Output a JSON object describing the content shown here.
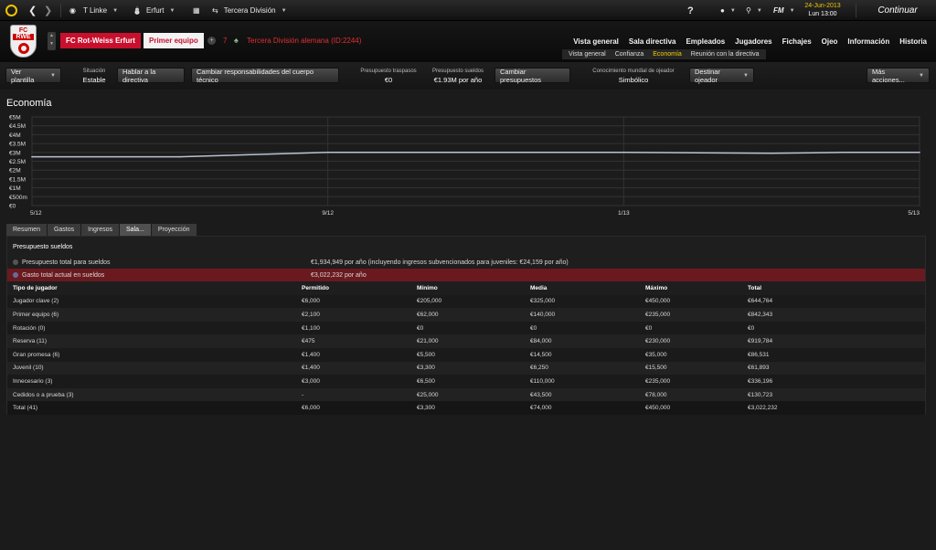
{
  "topbar": {
    "manager": "T Linke",
    "city": "Erfurt",
    "competition": "Tercera División",
    "help": "?",
    "date": "24-Jun-2013",
    "day_time": "Lun 13:00",
    "fm_label": "FM",
    "continue_label": "Continuar"
  },
  "club": {
    "crest_top": "FC",
    "crest_mid": "RWE",
    "name": "FC Rot-Weiss Erfurt",
    "team": "Primer equipo",
    "rank": "7",
    "league": "Tercera División alemana",
    "league_id": "(ID:2244)",
    "accent": "#c8102e"
  },
  "nav": {
    "items": [
      "Vista general",
      "Sala directiva",
      "Empleados",
      "Jugadores",
      "Fichajes",
      "Ojeo",
      "Información",
      "Historia"
    ],
    "subitems": [
      "Vista general",
      "Confianza",
      "Economía",
      "Reunión con la directiva"
    ],
    "active_sub": "Economía"
  },
  "info": {
    "view_squad": "Ver plantilla",
    "situation_label": "Situación",
    "situation_value": "Estable",
    "talk_board": "Hablar a la directiva",
    "change_resp": "Cambiar responsabilidades del cuerpo técnico",
    "transfer_budget_label": "Presupuesto traspasos",
    "transfer_budget_value": "€0",
    "wage_budget_label": "Presupuesto sueldos",
    "wage_budget_value": "€1.93M por año",
    "change_budgets": "Cambiar presupuestos",
    "scout_label": "Conocimiento mundial de ojeador",
    "scout_value": "Simbólico",
    "assign_scout": "Destinar ojeador",
    "more_actions": "Más acciones..."
  },
  "section_title": "Economía",
  "chart_data": {
    "type": "line",
    "title": "",
    "xlabel": "",
    "ylabel": "",
    "y_ticks": [
      "€5M",
      "€4.5M",
      "€4M",
      "€3.5M",
      "€3M",
      "€2.5M",
      "€2M",
      "€1.5M",
      "€1M",
      "€500m",
      "€0"
    ],
    "x_ticks": [
      "5/12",
      "9/12",
      "1/13",
      "5/13"
    ],
    "ylim": [
      0,
      5000000
    ],
    "xlim": [
      0,
      12
    ],
    "grid": true,
    "series": [
      {
        "x": [
          0,
          2,
          4,
          6,
          8,
          10,
          11,
          12
        ],
        "values": [
          2750000,
          2750000,
          3000000,
          3000000,
          3000000,
          2950000,
          3000000,
          3000000
        ]
      }
    ],
    "color": "#b7c3d3"
  },
  "tabs": [
    "Resumen",
    "Gastos",
    "Ingresos",
    "Sala...",
    "Proyección"
  ],
  "active_tab": "Sala...",
  "wages": {
    "title": "Presupuesto sueldos",
    "budget_label": "Presupuesto total para sueldos",
    "budget_value": "€1,934,949 por año (incluyendo ingresos subvencionados para juveniles: €24,159 por año)",
    "current_label": "Gasto total actual en sueldos",
    "current_value": "€3,022,232 por año",
    "warn_color": "#6a1a1f",
    "columns": [
      "Tipo de jugador",
      "Permitido",
      "Mínimo",
      "Media",
      "Máximo",
      "Total"
    ],
    "rows": [
      [
        "Jugador clave (2)",
        "€6,000",
        "€205,000",
        "€325,000",
        "€450,000",
        "€644,764"
      ],
      [
        "Primer equipo (6)",
        "€2,100",
        "€62,000",
        "€140,000",
        "€235,000",
        "€842,343"
      ],
      [
        "Rotación (0)",
        "€1,100",
        "€0",
        "€0",
        "€0",
        "€0"
      ],
      [
        "Reserva (11)",
        "€475",
        "€21,000",
        "€84,000",
        "€230,000",
        "€919,784"
      ],
      [
        "Gran promesa (6)",
        "€1,400",
        "€5,500",
        "€14,500",
        "€35,000",
        "€86,531"
      ],
      [
        "Juvenil (10)",
        "€1,400",
        "€3,300",
        "€6,250",
        "€15,500",
        "€61,893"
      ],
      [
        "Innecesario (3)",
        "€3,000",
        "€6,500",
        "€110,000",
        "€235,000",
        "€336,196"
      ],
      [
        "Cedidos o a prueba (3)",
        "-",
        "€25,000",
        "€43,500",
        "€78,000",
        "€130,723"
      ],
      [
        "Total (41)",
        "€6,000",
        "€3,300",
        "€74,000",
        "€450,000",
        "€3,022,232"
      ]
    ]
  }
}
